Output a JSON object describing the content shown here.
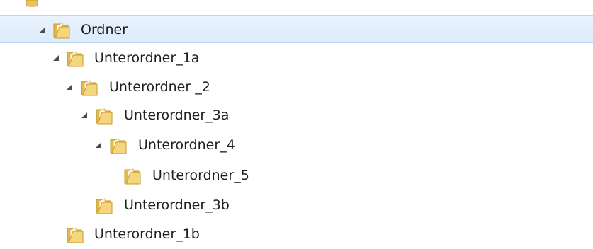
{
  "tree": {
    "items": [
      {
        "label": "Ordner",
        "expanded": true,
        "selected": true,
        "icon": "folder-icon"
      },
      {
        "label": "Unterordner_1a",
        "expanded": true,
        "selected": false,
        "icon": "folder-icon"
      },
      {
        "label": "Unterordner _2",
        "expanded": true,
        "selected": false,
        "icon": "folder-icon"
      },
      {
        "label": "Unterordner_3a",
        "expanded": true,
        "selected": false,
        "icon": "folder-icon"
      },
      {
        "label": "Unterordner_4",
        "expanded": true,
        "selected": false,
        "icon": "folder-icon"
      },
      {
        "label": "Unterordner_5",
        "expanded": false,
        "selected": false,
        "icon": "folder-icon"
      },
      {
        "label": "Unterordner_3b",
        "expanded": false,
        "selected": false,
        "icon": "folder-icon"
      },
      {
        "label": "Unterordner_1b",
        "expanded": false,
        "selected": false,
        "icon": "folder-icon"
      }
    ],
    "colors": {
      "selected_bg": "#dcebfc",
      "selected_border": "#bcd6f2",
      "text": "#1e1e1e",
      "folder_yellow": "#f5d67d",
      "expander": "#4d4d4d"
    }
  }
}
